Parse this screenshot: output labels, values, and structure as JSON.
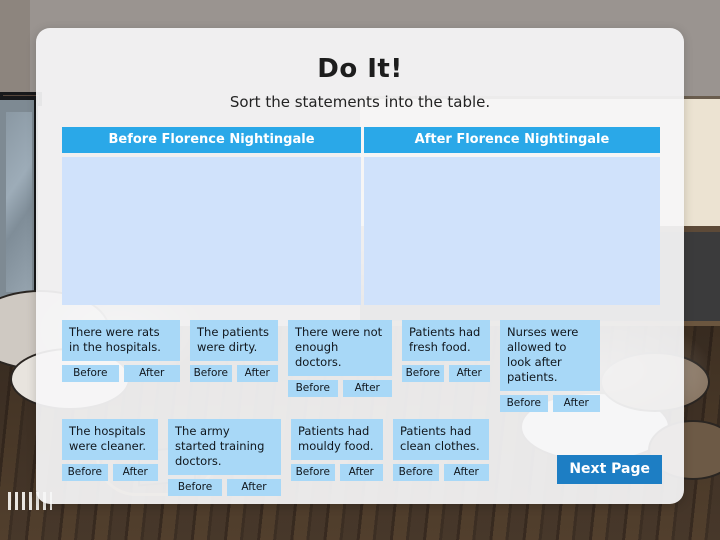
{
  "slide": {
    "title": "Do It!",
    "subtitle": "Sort the statements into the table."
  },
  "table": {
    "headers": {
      "before": "Before Florence Nightingale",
      "after": "After Florence Nightingale"
    },
    "before_items": [],
    "after_items": []
  },
  "options": {
    "before": "Before",
    "after": "After"
  },
  "cards": [
    {
      "text": "There were rats in the hospitals.",
      "before": "Before",
      "after": "After"
    },
    {
      "text": "The patients were dirty.",
      "before": "Before",
      "after": "After"
    },
    {
      "text": "There were not enough doctors.",
      "before": "Before",
      "after": "After"
    },
    {
      "text": "Patients had fresh food.",
      "before": "Before",
      "after": "After"
    },
    {
      "text": "Nurses were allowed to look after patients.",
      "before": "Before",
      "after": "After"
    },
    {
      "text": "The hospitals were cleaner.",
      "before": "Before",
      "after": "After"
    },
    {
      "text": "The army started training doctors.",
      "before": "Before",
      "after": "After"
    },
    {
      "text": "Patients had mouldy food.",
      "before": "Before",
      "after": "After"
    },
    {
      "text": "Patients had clean clothes.",
      "before": "Before",
      "after": "After"
    }
  ],
  "footer": {
    "next_page": "Next Page"
  },
  "colors": {
    "header_blue": "#2aa8e8",
    "dropzone_blue": "#d0e2fb",
    "card_blue": "#a8d8f7",
    "next_button_blue": "#1d7ec4",
    "panel_white": "#f6f6f7"
  }
}
